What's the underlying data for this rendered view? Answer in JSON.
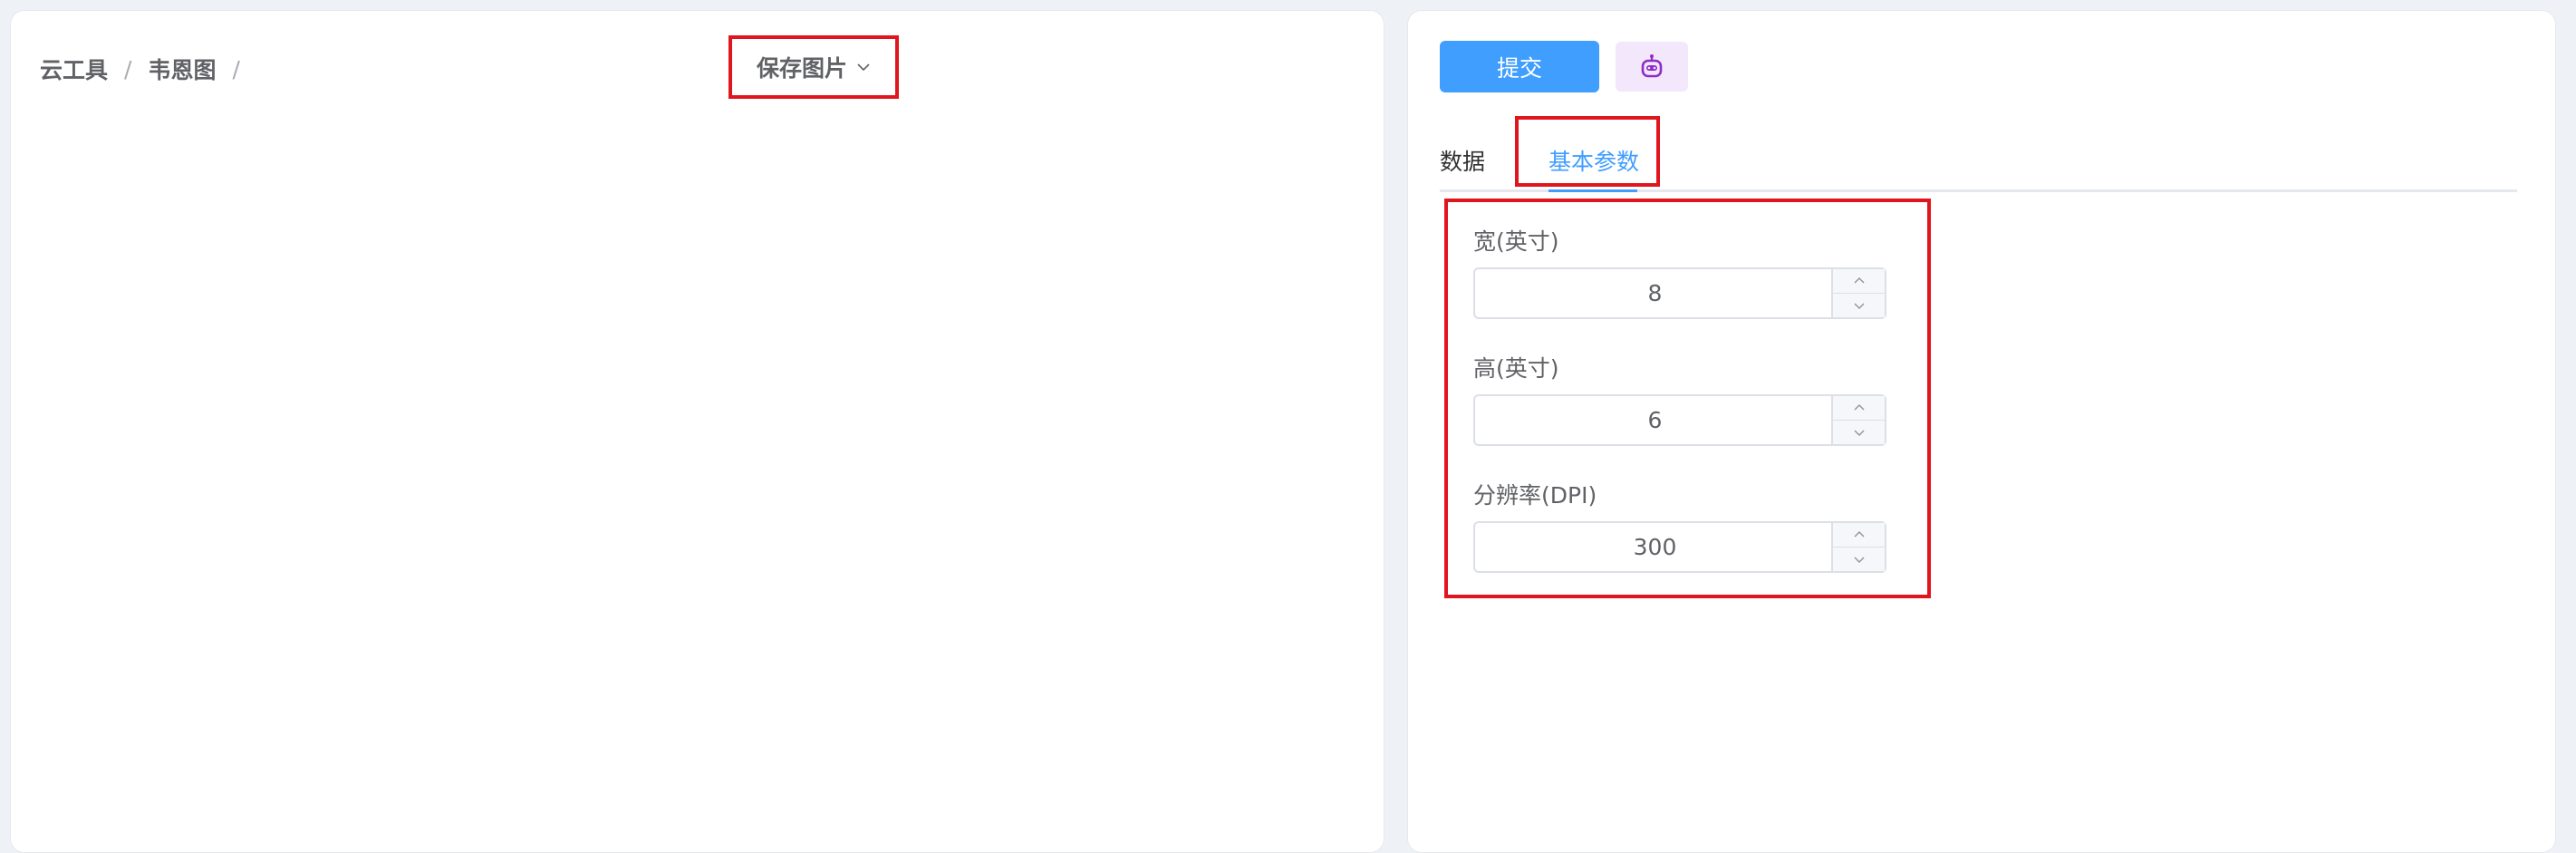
{
  "breadcrumb": {
    "items": [
      "云工具",
      "韦恩图"
    ],
    "separator": "/"
  },
  "save_menu": {
    "label": "保存图片",
    "icon": "chevron-down-icon"
  },
  "toolbar": {
    "submit_label": "提交",
    "ai_icon": "robot-icon"
  },
  "tabs": [
    {
      "label": "数据",
      "active": false
    },
    {
      "label": "基本参数",
      "active": true
    }
  ],
  "form": {
    "width": {
      "label": "宽(英寸)",
      "value": "8"
    },
    "height": {
      "label": "高(英寸)",
      "value": "6"
    },
    "dpi": {
      "label": "分辨率(DPI)",
      "value": "300"
    }
  },
  "colors": {
    "accent": "#409eff",
    "highlight": "#e0161f",
    "ai_bg": "#f3e8fb",
    "ai_icon": "#8e2cc6"
  }
}
